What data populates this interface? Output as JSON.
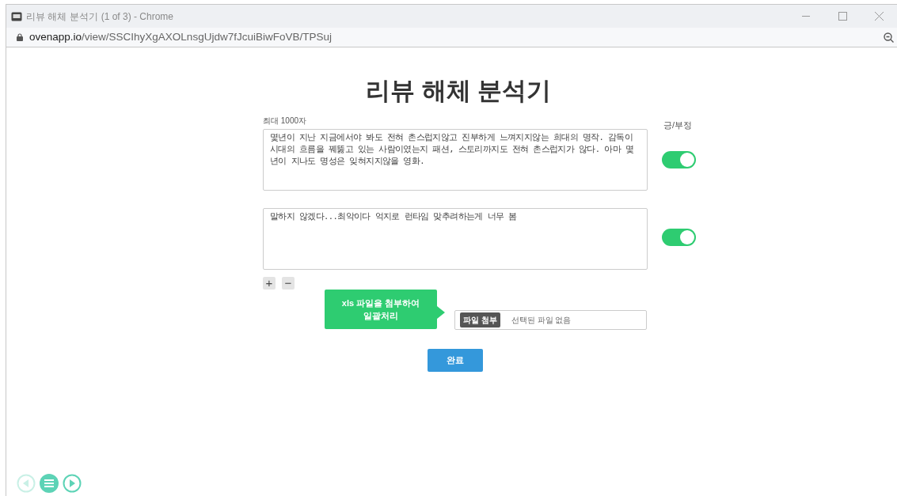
{
  "window": {
    "title": "리뷰 해체 분석기",
    "title_suffix": "(1 of 3) - Chrome",
    "url_host": "ovenapp.io",
    "url_path": "/view/SSCIhyXgAXOLnsgUjdw7fJcuiBiwFoVB/TPSuj"
  },
  "page": {
    "heading": "리뷰 해체 분석기",
    "limit_label": "최대 1000자",
    "sentiment_label": "긍/부정"
  },
  "reviews": [
    {
      "value": "몇년이 지난 지금에서야 봐도 전혀 촌스럽지않고 진부하게 느껴지지않는 희대의 명작. 감독이 시대의 흐름을 꿰뚫고 있는 사람이였는지 패션, 스토리까지도 전혀 촌스럽지가 않다. 아마 몇년이 지나도 명성은 잊혀지지않을 영화.",
      "on": true
    },
    {
      "value": "말하지 않겠다...최악이다 억지로 런타임 맞추려하는게 너무 봄",
      "on": true
    }
  ],
  "row_buttons": [
    "+",
    "−"
  ],
  "callout": {
    "text": "xls 파일을 첨부하여 일괄처리"
  },
  "file": {
    "button": "파일 첨부",
    "status": "선택된 파일 없음"
  },
  "submit": "완료",
  "player": [
    {
      "kind": "prev",
      "disabled": true
    },
    {
      "kind": "menu",
      "disabled": false
    },
    {
      "kind": "next",
      "disabled": false
    }
  ]
}
